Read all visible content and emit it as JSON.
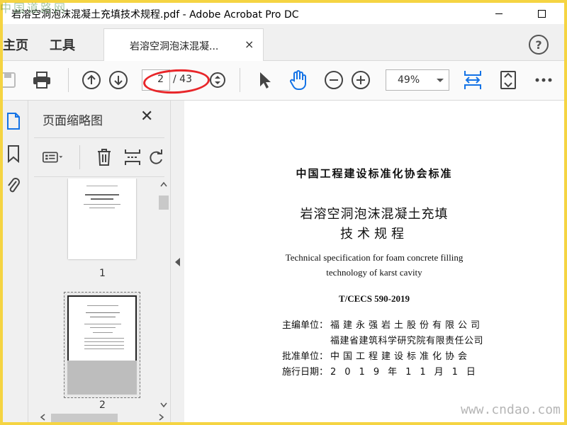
{
  "window": {
    "title": "岩溶空洞泡沫混凝土充填技术规程.pdf - Adobe Acrobat Pro DC"
  },
  "tabs": {
    "home": "主页",
    "tools": "工具",
    "document": "岩溶空洞泡沫混凝...",
    "close": "×",
    "help": "?"
  },
  "toolbar": {
    "current_page": "2",
    "total_pages": "/ 43",
    "zoom": "49%"
  },
  "thumbnails": {
    "title": "页面缩略图",
    "close": "✕",
    "pages": [
      {
        "label": "1"
      },
      {
        "label": "2"
      }
    ]
  },
  "document": {
    "org": "中国工程建设标准化协会标准",
    "title_line1": "岩溶空洞泡沫混凝土充填",
    "title_line2": "技术规程",
    "english_line1": "Technical specification for foam concrete filling",
    "english_line2": "technology of karst cavity",
    "code": "T/CECS 590-2019",
    "chief_label": "主编单位：",
    "chief_1": "福建永强岩土股份有限公司",
    "chief_2": "福建省建筑科学研究院有限责任公司",
    "approve_label": "批准单位：",
    "approve": "中国工程建设标准化协会",
    "date_label": "施行日期：",
    "date": "2019年11月1日"
  },
  "watermarks": {
    "top_left": "中国道路网",
    "bottom_right": "www.cndao.com"
  },
  "colors": {
    "accent_blue": "#1473e6",
    "annotation_red": "#e8262a",
    "frame_yellow": "#f5d442"
  }
}
